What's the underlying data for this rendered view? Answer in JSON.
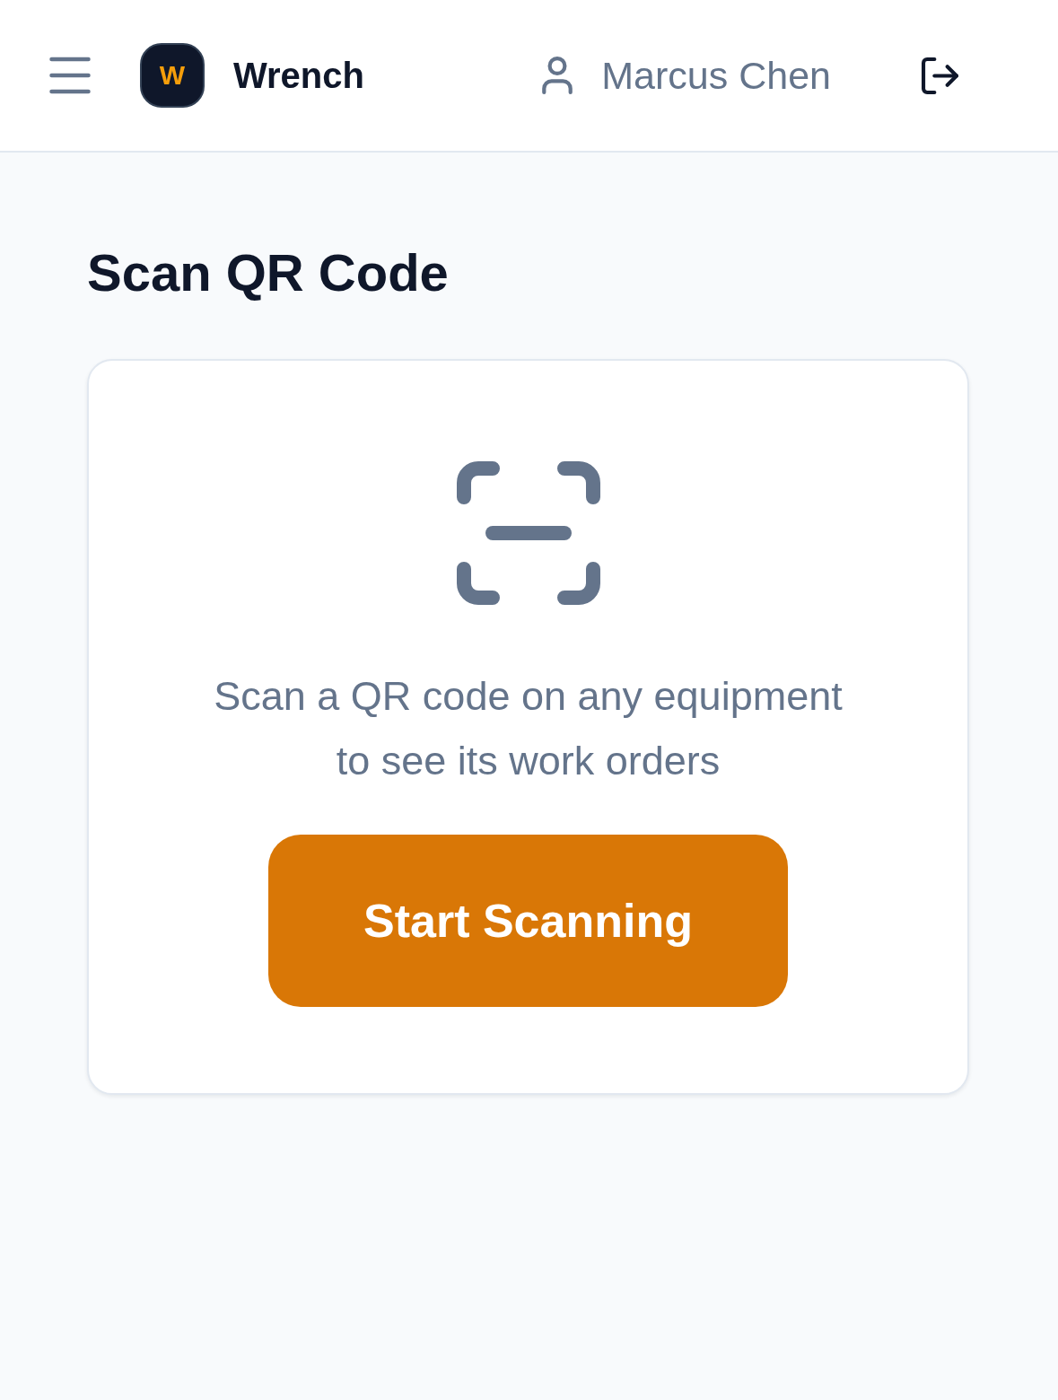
{
  "header": {
    "logo_letter": "W",
    "app_name": "Wrench",
    "user_name": "Marcus Chen"
  },
  "page": {
    "title": "Scan QR Code"
  },
  "scan_card": {
    "message": "Scan a QR code on any equipment to see its work orders",
    "button": "Start Scanning"
  }
}
